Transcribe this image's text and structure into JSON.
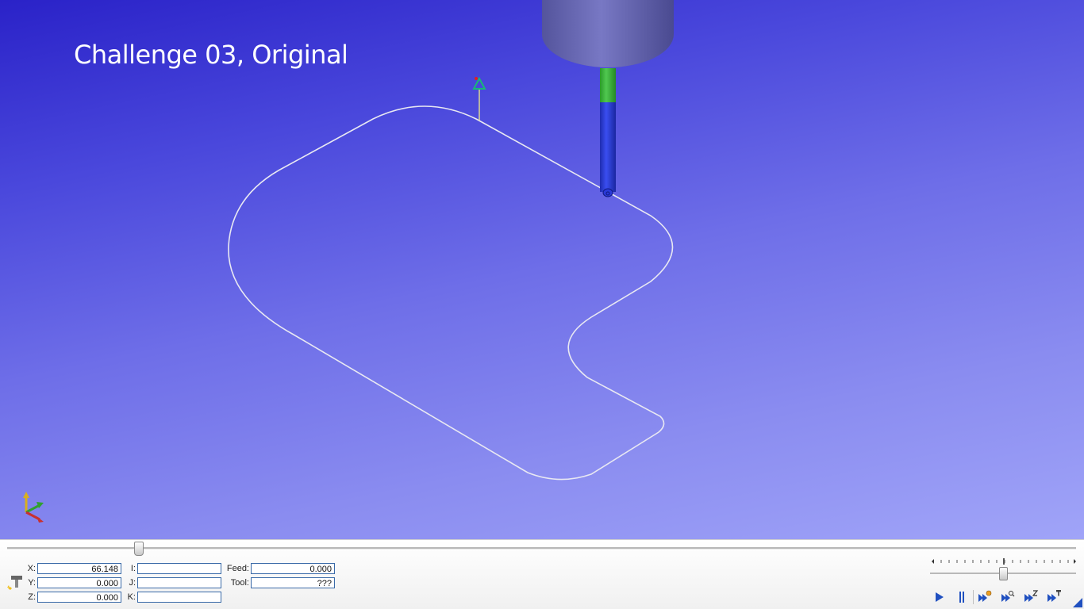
{
  "viewport": {
    "title": "Challenge 03, Original",
    "background_top": "#2a22c8",
    "background_bottom": "#a0a4f8",
    "toolpath_color": "#e6e6f0",
    "tool_holder_color": "#6464b4",
    "tool_collar_color": "#3cb43c",
    "tool_shank_color": "#2a3ad8"
  },
  "axes_icon": "xyz-axis-triad-icon",
  "simulation": {
    "position_label": {
      "x": "X:",
      "y": "Y:",
      "z": "Z:"
    },
    "position_value": {
      "x": "66.148",
      "y": "0.000",
      "z": "0.000"
    },
    "arc_label": {
      "i": "I:",
      "j": "J:",
      "k": "K:"
    },
    "arc_value": {
      "i": "",
      "j": "",
      "k": ""
    },
    "feed_label": "Feed:",
    "feed_value": "0.000",
    "tool_label": "Tool:",
    "tool_value": "???"
  },
  "controls": {
    "play": "play-icon",
    "pause": "pause-icon",
    "step_to_point": "step-to-point-icon",
    "step_to_search": "step-to-search-icon",
    "step_to_z": "step-to-z-icon",
    "step_to_tool": "step-to-tool-icon"
  }
}
